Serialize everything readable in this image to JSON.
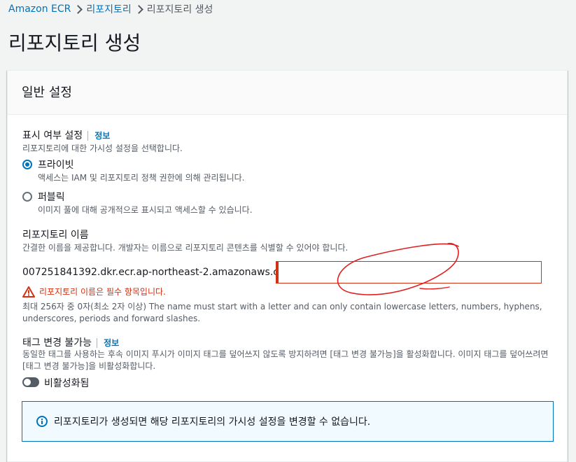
{
  "breadcrumb": {
    "items": [
      "Amazon ECR",
      "리포지토리",
      "리포지토리 생성"
    ]
  },
  "page_title": "리포지토리 생성",
  "panel": {
    "title": "일반 설정"
  },
  "visibility": {
    "label": "표시 여부 설정",
    "info": "정보",
    "description": "리포지토리에 대한 가시성 설정을 선택합니다.",
    "selected": "private",
    "options": [
      {
        "label": "프라이빗",
        "description": "액세스는 IAM 및 리포지토리 정책 권한에 의해 관리됩니다."
      },
      {
        "label": "퍼블릭",
        "description": "이미지 풀에 대해 공개적으로 표시되고 액세스할 수 있습니다."
      }
    ]
  },
  "repo_name": {
    "label": "리포지토리 이름",
    "description": "간결한 이름을 제공합니다. 개발자는 이름으로 리포지토리 콘텐츠를 식별할 수 있어야 합니다.",
    "prefix": "007251841392.dkr.ecr.ap-northeast-2.amazonaws.com/",
    "value": "",
    "error": "리포지토리 이름은 필수 항목입니다.",
    "constraint": "최대 256자 중 0자(최소 2자 이상) The name must start with a letter and can only contain lowercase letters, numbers, hyphens, underscores, periods and forward slashes."
  },
  "tag_immutability": {
    "label": "태그 변경 불가능",
    "info": "정보",
    "description": "동일한 태그를 사용하는 후속 이미지 푸시가 이미지 태그를 덮어쓰지 않도록 방지하려면 [태그 변경 불가능]을 활성화합니다. 이미지 태그를 덮어쓰려면 [태그 변경 불가능]을 비활성화합니다.",
    "toggle_label": "비활성화됨",
    "enabled": false
  },
  "alert": {
    "text": "리포지토리가 생성되면 해당 리포지토리의 가시성 설정을 변경할 수 없습니다."
  },
  "colors": {
    "link": "#0073bb",
    "error": "#d13212",
    "annotation": "#e02020"
  }
}
